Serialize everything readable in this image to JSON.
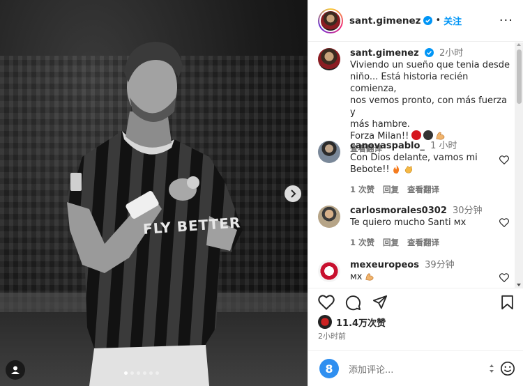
{
  "post": {
    "author": "sant.gimenez",
    "follow_label": "关注",
    "separator": "•",
    "more_label": "···",
    "jersey_sponsor": "FLY BETTER"
  },
  "caption": {
    "username": "sant.gimenez",
    "time": "2小时",
    "text_lines": [
      "Viviendo un sueño que tenia desde",
      "niño... Está historia recién comienza,",
      "nos vemos pronto, con más fuerza y",
      "más hambre."
    ],
    "forza": "Forza Milan!!",
    "translate": "查看翻译"
  },
  "comments": [
    {
      "username": "canovaspablo_",
      "time": "1 小时",
      "text_line1": "Con Dios delante, vamos mi",
      "text_line2": "Bebote!!",
      "likes": "1 次赞",
      "reply": "回复",
      "translate": "查看翻译"
    },
    {
      "username": "carlosmorales0302",
      "time": "30分钟",
      "text": "Te quiero mucho Santi ᴍx",
      "likes": "1 次赞",
      "reply": "回复",
      "translate": "查看翻译"
    },
    {
      "username": "mexeuropeos",
      "time": "39分钟",
      "text": "ᴍx"
    }
  ],
  "stats": {
    "likes": "11.4万次赞",
    "posted": "2小时前"
  },
  "add_comment": {
    "avatar_letter": "8",
    "placeholder": "添加评论..."
  },
  "colors": {
    "accent": "#0095f6",
    "milan_red": "#d5161e"
  },
  "carousel": {
    "count": 6,
    "active": 1
  }
}
